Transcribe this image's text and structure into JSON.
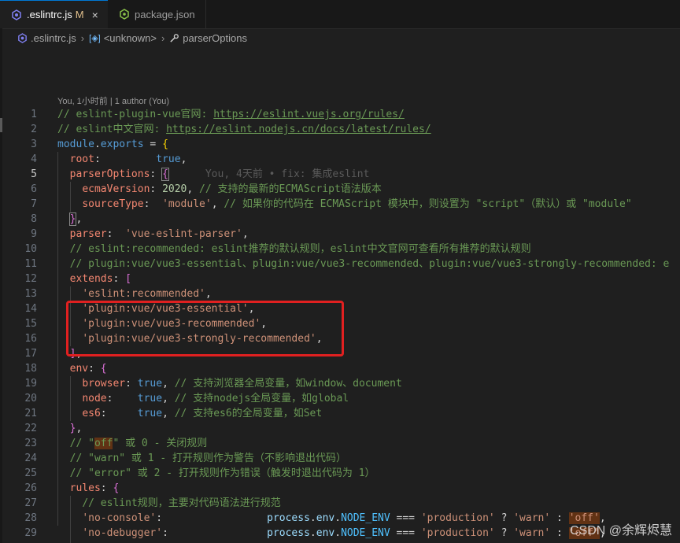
{
  "tabs": [
    {
      "label": ".eslintrc.js",
      "modified": "M",
      "close": "×",
      "icon": "eslint-icon"
    },
    {
      "label": "package.json",
      "icon": "json-icon"
    }
  ],
  "breadcrumb": [
    {
      "label": ".eslintrc.js",
      "icon": "eslint-icon"
    },
    {
      "label": "<unknown>",
      "icon": "symbol-object-icon"
    },
    {
      "label": "parserOptions",
      "icon": "wrench-icon"
    }
  ],
  "codelens": "You, 1小时前 | 1 author (You)",
  "inline_blame": "You, 4天前 • fix: 集成eslint",
  "line_numbers": [
    "1",
    "2",
    "3",
    "4",
    "5",
    "6",
    "7",
    "8",
    "9",
    "10",
    "11",
    "12",
    "13",
    "14",
    "15",
    "16",
    "17",
    "18",
    "19",
    "20",
    "21",
    "22",
    "23",
    "24",
    "25",
    "26",
    "27",
    "28",
    "29"
  ],
  "current_line": 5,
  "code": {
    "l1_comment": "// eslint-plugin-vue官网: ",
    "l1_link": "https://eslint.vuejs.org/rules/",
    "l2_comment": "// eslint中文官网: ",
    "l2_link": "https://eslint.nodejs.cn/docs/latest/rules/",
    "l3_module": "module",
    "l3_exports": "exports",
    "l4_key": "root",
    "l4_val": "true",
    "l5_key": "parserOptions",
    "l6_key": "ecmaVersion",
    "l6_num": "2020",
    "l6_comment": "// 支持的最新的ECMAScript语法版本",
    "l7_key": "sourceType",
    "l7_str": "'module'",
    "l7_comment": "// 如果你的代码在 ECMAScript 模块中，则设置为 \"script\"（默认）或 \"module\"",
    "l9_key": "parser",
    "l9_str": "'vue-eslint-parser'",
    "l10_comment": "// eslint:recommended: eslint推荐的默认规则，eslint中文官网可查看所有推荐的默认规则",
    "l11_comment": "// plugin:vue/vue3-essential、plugin:vue/vue3-recommended、plugin:vue/vue3-strongly-recommended: e",
    "l12_key": "extends",
    "l13_str": "'eslint:recommended'",
    "l14_str": "'plugin:vue/vue3-essential'",
    "l15_str": "'plugin:vue/vue3-recommended'",
    "l16_str": "'plugin:vue/vue3-strongly-recommended'",
    "l18_key": "env",
    "l19_key": "browser",
    "l19_val": "true",
    "l19_comment": "// 支持浏览器全局变量，如window、document",
    "l20_key": "node",
    "l20_val": "true",
    "l20_comment": "// 支持nodejs全局变量，如global",
    "l21_key": "es6",
    "l21_val": "true",
    "l21_comment": "// 支持es6的全局变量，如Set",
    "l23_pre": "// \"",
    "l23_off": "off",
    "l23_post": "\" 或 0 - 关闭规则",
    "l24_comment": "// \"warn\" 或 1 - 打开规则作为警告（不影响退出代码）",
    "l25_comment": "// \"error\" 或 2 - 打开规则作为错误（触发时退出代码为 1）",
    "l26_key": "rules",
    "l27_comment": "// eslint规则，主要对代码语法进行规范",
    "l28_key": "'no-console'",
    "l29_key": "'no-debugger'",
    "rule_process": "process",
    "rule_env": "env",
    "rule_node_env": "NODE_ENV",
    "rule_eq": " === ",
    "rule_production": "'production'",
    "rule_warn": "'warn'",
    "rule_off": "'off'"
  },
  "watermark": "CSDN @余辉烬慧",
  "colors": {
    "editor_bg": "#1f1f1f",
    "comment": "#6a9955",
    "string": "#ce9178",
    "property": "#9cdcfe",
    "keyword": "#569cd6",
    "annotation_box": "#e02020"
  }
}
